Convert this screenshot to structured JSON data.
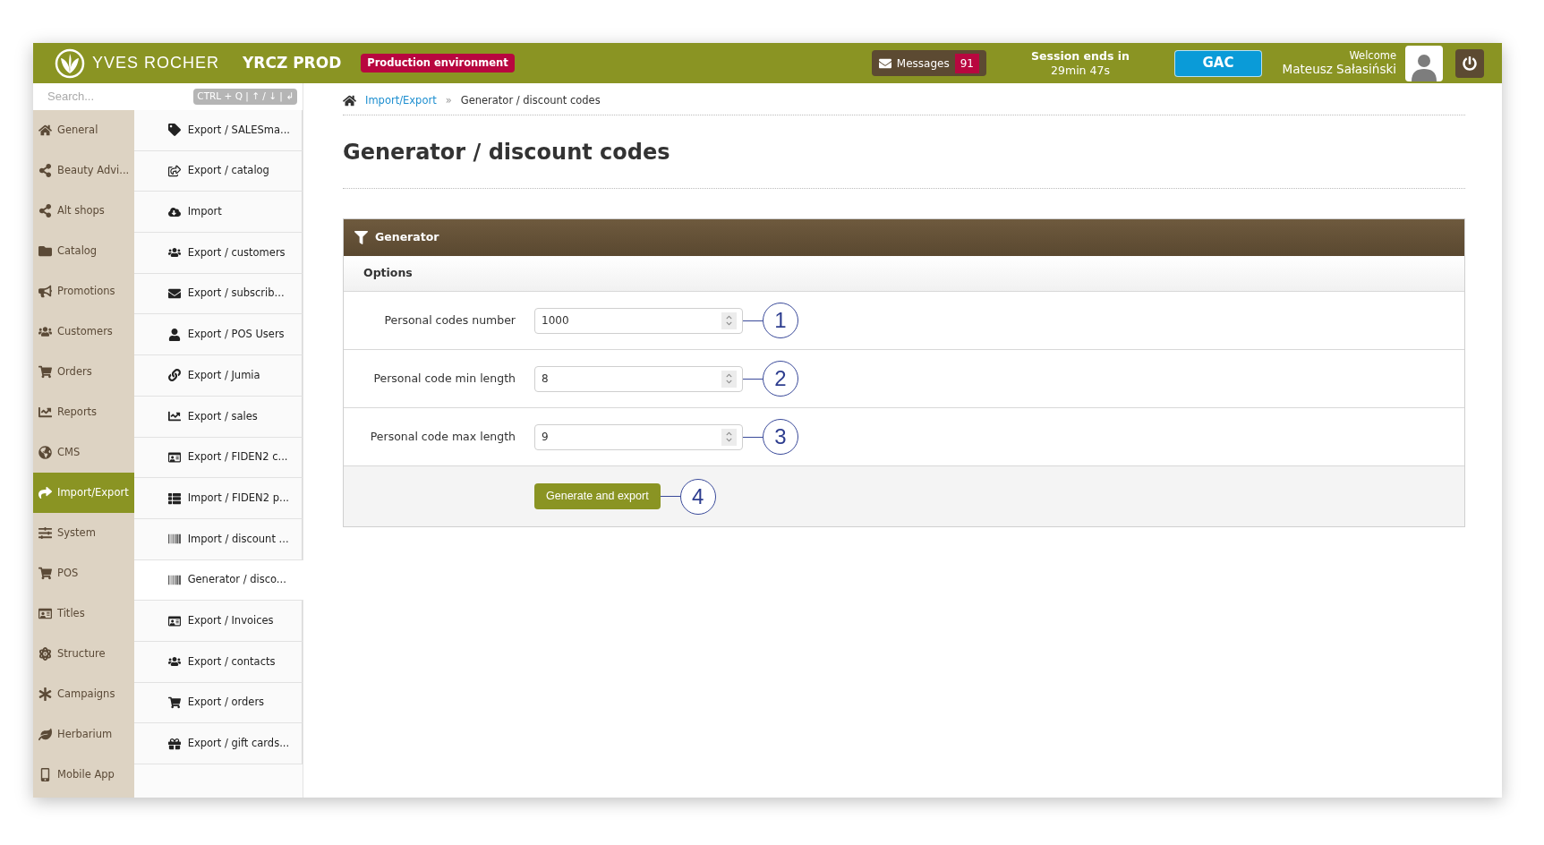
{
  "header": {
    "logo": "YVES ROCHER",
    "app_name": "YRCZ PROD",
    "environment": "Production environment",
    "messages": {
      "label": "Messages",
      "count": "91"
    },
    "session": {
      "label": "Session ends in",
      "time": "29min 47s"
    },
    "account_button": "GAC",
    "welcome": "Welcome",
    "user_name": "Mateusz Sałasiński"
  },
  "sidebar": {
    "search": {
      "placeholder": "Search...",
      "shortcut": "CTRL + Q | ↑ / ↓ | ↲"
    },
    "nav": [
      {
        "label": "General",
        "selected": false
      },
      {
        "label": "Beauty Advi...",
        "selected": false
      },
      {
        "label": "Alt shops",
        "selected": false
      },
      {
        "label": "Catalog",
        "selected": false
      },
      {
        "label": "Promotions",
        "selected": false
      },
      {
        "label": "Customers",
        "selected": false
      },
      {
        "label": "Orders",
        "selected": false
      },
      {
        "label": "Reports",
        "selected": false
      },
      {
        "label": "CMS",
        "selected": false
      },
      {
        "label": "Import/Export",
        "selected": true
      },
      {
        "label": "System",
        "selected": false
      },
      {
        "label": "POS",
        "selected": false
      },
      {
        "label": "Titles",
        "selected": false
      },
      {
        "label": "Structure",
        "selected": false
      },
      {
        "label": "Campaigns",
        "selected": false
      },
      {
        "label": "Herbarium",
        "selected": false
      },
      {
        "label": "Mobile App",
        "selected": false
      }
    ],
    "submenu": [
      {
        "label": "Export / SALESma...",
        "selected": false
      },
      {
        "label": "Export / catalog",
        "selected": false
      },
      {
        "label": "Import",
        "selected": false
      },
      {
        "label": "Export / customers",
        "selected": false
      },
      {
        "label": "Export / subscrib...",
        "selected": false
      },
      {
        "label": "Export / POS Users",
        "selected": false
      },
      {
        "label": "Export / Jumia",
        "selected": false
      },
      {
        "label": "Export / sales",
        "selected": false
      },
      {
        "label": "Export / FIDEN2 c...",
        "selected": false
      },
      {
        "label": "Import / FIDEN2 p...",
        "selected": false
      },
      {
        "label": "Import / discount ...",
        "selected": false
      },
      {
        "label": "Generator / disco...",
        "selected": true
      },
      {
        "label": "Export / Invoices",
        "selected": false
      },
      {
        "label": "Export / contacts",
        "selected": false
      },
      {
        "label": "Export / orders",
        "selected": false
      },
      {
        "label": "Export / gift cards...",
        "selected": false
      }
    ]
  },
  "breadcrumb": [
    {
      "label": "Import/Export",
      "kind": "link"
    },
    {
      "label": "»",
      "kind": "separator"
    },
    {
      "label": "Generator / discount codes",
      "kind": "current"
    }
  ],
  "page_title": "Generator / discount codes",
  "panel": {
    "title": "Generator",
    "section": "Options",
    "fields": [
      {
        "label": "Personal codes number",
        "value": "1000",
        "callout": "1"
      },
      {
        "label": "Personal code min length",
        "value": "8",
        "callout": "2"
      },
      {
        "label": "Personal code max length",
        "value": "9",
        "callout": "3"
      }
    ],
    "button": {
      "label": "Generate and export",
      "callout": "4"
    }
  }
}
